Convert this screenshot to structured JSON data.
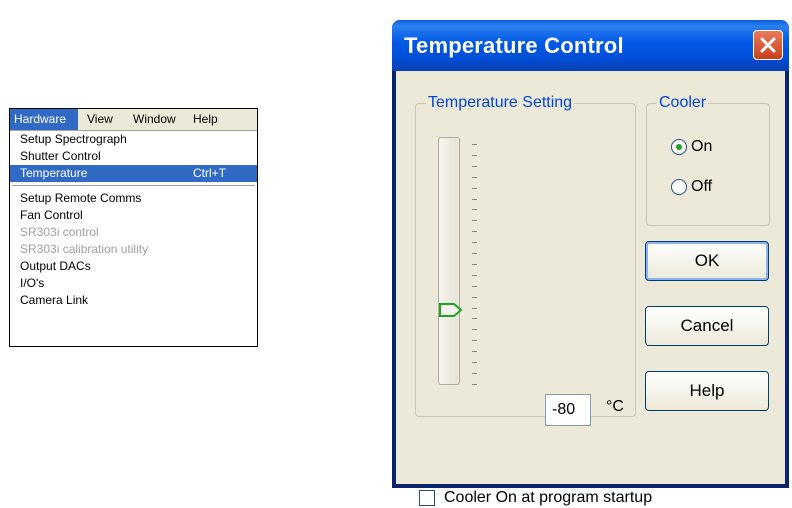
{
  "menu": {
    "bar": [
      {
        "label": "Hardware",
        "active": true
      },
      {
        "label": "View",
        "active": false
      },
      {
        "label": "Window",
        "active": false
      },
      {
        "label": "Help",
        "active": false
      }
    ],
    "items": [
      {
        "label": "Setup Spectrograph",
        "shortcut": "",
        "state": "normal"
      },
      {
        "label": "Shutter Control",
        "shortcut": "",
        "state": "normal"
      },
      {
        "label": "Temperature",
        "shortcut": "Ctrl+T",
        "state": "highlight"
      },
      {
        "label": "Setup Remote Comms",
        "shortcut": "",
        "state": "normal"
      },
      {
        "label": "Fan Control",
        "shortcut": "",
        "state": "normal"
      },
      {
        "label": "SR303i control",
        "shortcut": "",
        "state": "disabled"
      },
      {
        "label": "SR303i calibration utility",
        "shortcut": "",
        "state": "disabled"
      },
      {
        "label": "Output DACs",
        "shortcut": "",
        "state": "normal"
      },
      {
        "label": "I/O's",
        "shortcut": "",
        "state": "normal"
      },
      {
        "label": "Camera Link",
        "shortcut": "",
        "state": "normal"
      }
    ]
  },
  "dialog": {
    "title": "Temperature Control",
    "temperature_setting": {
      "label": "Temperature Setting",
      "value": "-80",
      "unit": "°C"
    },
    "cooler": {
      "label": "Cooler",
      "on_label": "On",
      "off_label": "Off",
      "selected": "On"
    },
    "buttons": {
      "ok": "OK",
      "cancel": "Cancel",
      "help": "Help"
    },
    "startup_checkbox": {
      "label": "Cooler On at program startup",
      "checked": false
    }
  },
  "colors": {
    "menu_highlight": "#316ac5",
    "group_title": "#0046d5",
    "titlebar": "#0058e6",
    "close_button": "#c5421d",
    "dialog_face": "#ece9d8"
  }
}
